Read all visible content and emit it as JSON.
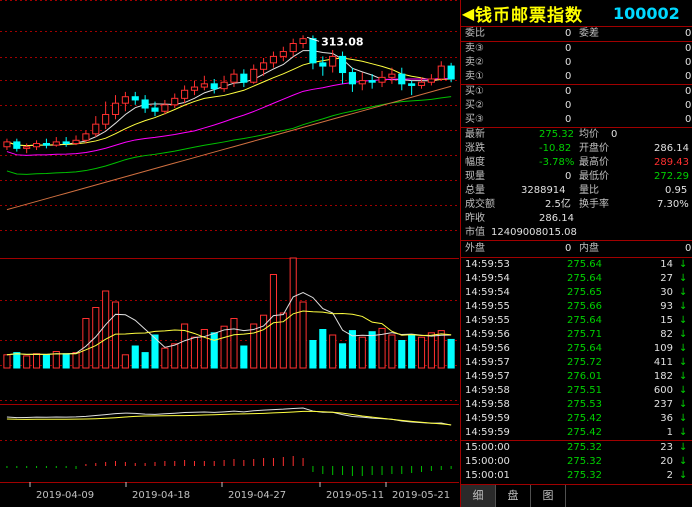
{
  "stock": {
    "name": "钱币邮票指数",
    "code": "100002",
    "nav_prev": "◀",
    "nav_next": "▶"
  },
  "order_book": {
    "ratio_label": "委比",
    "ratio_value": "0",
    "diff_label": "委差",
    "diff_value": "0",
    "sells": [
      {
        "label": "卖③",
        "price": "",
        "vol": "0"
      },
      {
        "label": "卖②",
        "price": "",
        "vol": "0"
      },
      {
        "label": "卖①",
        "price": "",
        "vol": "0"
      }
    ],
    "buys": [
      {
        "label": "买①",
        "price": "",
        "vol": "0"
      },
      {
        "label": "买②",
        "price": "",
        "vol": "0"
      },
      {
        "label": "买③",
        "price": "",
        "vol": "0"
      }
    ],
    "zero": "0"
  },
  "quote": {
    "latest_label": "最新",
    "latest": "275.32",
    "avg_label": "均价",
    "avg": "0",
    "change_label": "涨跌",
    "change": "-10.82",
    "open_label": "开盘价",
    "open": "286.14",
    "pct_label": "幅度",
    "pct": "-3.78%",
    "high_label": "最高价",
    "high": "289.43",
    "cur_vol_label": "现量",
    "cur_vol": "0",
    "low_label": "最低价",
    "low": "272.29",
    "total_vol_label": "总量",
    "total_vol": "3288914",
    "vol_ratio_label": "量比",
    "vol_ratio": "0.95",
    "amount_label": "成交额",
    "amount": "2.5亿",
    "turnover_label": "换手率",
    "turnover": "7.30%",
    "prev_close_label": "昨收",
    "prev_close": "286.14",
    "mkt_cap_label": "市值",
    "mkt_cap": "12409008015.08"
  },
  "outer_inner": {
    "outer_label": "外盘",
    "outer": "0",
    "inner_label": "内盘",
    "inner": "0"
  },
  "ticks": [
    {
      "time": "14:59:53",
      "price": "275.64",
      "vol": "14",
      "dir": "down"
    },
    {
      "time": "14:59:54",
      "price": "275.64",
      "vol": "27",
      "dir": "down"
    },
    {
      "time": "14:59:54",
      "price": "275.65",
      "vol": "30",
      "dir": "down"
    },
    {
      "time": "14:59:55",
      "price": "275.66",
      "vol": "93",
      "dir": "down"
    },
    {
      "time": "14:59:55",
      "price": "275.64",
      "vol": "15",
      "dir": "down"
    },
    {
      "time": "14:59:56",
      "price": "275.71",
      "vol": "82",
      "dir": "down"
    },
    {
      "time": "14:59:56",
      "price": "275.64",
      "vol": "109",
      "dir": "down"
    },
    {
      "time": "14:59:57",
      "price": "275.72",
      "vol": "411",
      "dir": "down"
    },
    {
      "time": "14:59:57",
      "price": "276.01",
      "vol": "182",
      "dir": "down"
    },
    {
      "time": "14:59:58",
      "price": "275.51",
      "vol": "600",
      "dir": "down"
    },
    {
      "time": "14:59:58",
      "price": "275.53",
      "vol": "237",
      "dir": "down"
    },
    {
      "time": "14:59:59",
      "price": "275.42",
      "vol": "36",
      "dir": "down"
    },
    {
      "time": "14:59:59",
      "price": "275.42",
      "vol": "1",
      "dir": "down"
    },
    {
      "time": "15:00:00",
      "price": "275.32",
      "vol": "23",
      "dir": "down"
    },
    {
      "time": "15:00:00",
      "price": "275.32",
      "vol": "20",
      "dir": "down"
    },
    {
      "time": "15:00:01",
      "price": "275.32",
      "vol": "2",
      "dir": "down"
    }
  ],
  "tabs": [
    "细",
    "盘",
    "图"
  ],
  "colors": {
    "up": "#ff3030",
    "down": "#00ffff",
    "ma_white": "#e0e0e0",
    "ma_yellow": "#ffff40",
    "ma_magenta": "#ff00ff",
    "ma_green": "#00c000",
    "ma_orange": "#d07040",
    "grid": "#a00000"
  },
  "chart_data": {
    "type": "candlestick",
    "high_label": "313.08",
    "x_labels": [
      "2019-04-09",
      "2019-04-18",
      "2019-04-27",
      "2019-05-11",
      "2019-05-21"
    ],
    "ylim": [
      180,
      330
    ],
    "candles": [
      {
        "o": 244,
        "c": 247,
        "h": 249,
        "l": 242
      },
      {
        "o": 247,
        "c": 243,
        "h": 249,
        "l": 241
      },
      {
        "o": 243,
        "c": 244,
        "h": 246,
        "l": 240
      },
      {
        "o": 244,
        "c": 246,
        "h": 248,
        "l": 242
      },
      {
        "o": 246,
        "c": 245,
        "h": 249,
        "l": 243
      },
      {
        "o": 245,
        "c": 247,
        "h": 250,
        "l": 244
      },
      {
        "o": 247,
        "c": 246,
        "h": 250,
        "l": 244
      },
      {
        "o": 246,
        "c": 248,
        "h": 251,
        "l": 245
      },
      {
        "o": 248,
        "c": 252,
        "h": 254,
        "l": 246
      },
      {
        "o": 252,
        "c": 258,
        "h": 263,
        "l": 250
      },
      {
        "o": 258,
        "c": 264,
        "h": 272,
        "l": 255
      },
      {
        "o": 264,
        "c": 271,
        "h": 276,
        "l": 261
      },
      {
        "o": 271,
        "c": 275,
        "h": 278,
        "l": 266
      },
      {
        "o": 275,
        "c": 273,
        "h": 278,
        "l": 270
      },
      {
        "o": 273,
        "c": 268,
        "h": 276,
        "l": 265
      },
      {
        "o": 268,
        "c": 266,
        "h": 272,
        "l": 263
      },
      {
        "o": 266,
        "c": 270,
        "h": 273,
        "l": 264
      },
      {
        "o": 270,
        "c": 274,
        "h": 277,
        "l": 268
      },
      {
        "o": 274,
        "c": 279,
        "h": 282,
        "l": 271
      },
      {
        "o": 279,
        "c": 281,
        "h": 285,
        "l": 276
      },
      {
        "o": 281,
        "c": 283,
        "h": 288,
        "l": 279
      },
      {
        "o": 283,
        "c": 280,
        "h": 286,
        "l": 277
      },
      {
        "o": 280,
        "c": 284,
        "h": 288,
        "l": 278
      },
      {
        "o": 284,
        "c": 289,
        "h": 292,
        "l": 281
      },
      {
        "o": 289,
        "c": 284,
        "h": 292,
        "l": 281
      },
      {
        "o": 284,
        "c": 292,
        "h": 295,
        "l": 283
      },
      {
        "o": 292,
        "c": 296,
        "h": 299,
        "l": 288
      },
      {
        "o": 296,
        "c": 300,
        "h": 303,
        "l": 293
      },
      {
        "o": 300,
        "c": 303,
        "h": 306,
        "l": 297
      },
      {
        "o": 303,
        "c": 308,
        "h": 311,
        "l": 300
      },
      {
        "o": 308,
        "c": 311,
        "h": 313.08,
        "l": 305
      },
      {
        "o": 311,
        "c": 296,
        "h": 313,
        "l": 292
      },
      {
        "o": 296,
        "c": 294,
        "h": 300,
        "l": 288
      },
      {
        "o": 294,
        "c": 300,
        "h": 304,
        "l": 290
      },
      {
        "o": 300,
        "c": 290,
        "h": 303,
        "l": 283
      },
      {
        "o": 290,
        "c": 283,
        "h": 293,
        "l": 278
      },
      {
        "o": 283,
        "c": 285,
        "h": 290,
        "l": 279
      },
      {
        "o": 285,
        "c": 284,
        "h": 289,
        "l": 280
      },
      {
        "o": 284,
        "c": 287,
        "h": 291,
        "l": 281
      },
      {
        "o": 287,
        "c": 289,
        "h": 293,
        "l": 283
      },
      {
        "o": 289,
        "c": 283,
        "h": 293,
        "l": 279
      },
      {
        "o": 283,
        "c": 282,
        "h": 285,
        "l": 276
      },
      {
        "o": 282,
        "c": 284,
        "h": 287,
        "l": 280
      },
      {
        "o": 284,
        "c": 286,
        "h": 289,
        "l": 282
      },
      {
        "o": 286,
        "c": 294,
        "h": 297,
        "l": 285
      },
      {
        "o": 294,
        "c": 286,
        "h": 296,
        "l": 284
      }
    ],
    "volume": {
      "ylim": [
        0,
        100
      ],
      "values": [
        12,
        14,
        11,
        13,
        12,
        15,
        13,
        14,
        45,
        55,
        70,
        60,
        12,
        20,
        14,
        30,
        18,
        22,
        40,
        28,
        35,
        32,
        38,
        45,
        20,
        40,
        48,
        85,
        50,
        100,
        60,
        25,
        35,
        30,
        22,
        34,
        28,
        33,
        36,
        30,
        25,
        30,
        28,
        32,
        34,
        26
      ]
    },
    "macd_hist": [
      -2,
      -2,
      -2,
      -2,
      -2,
      -2,
      -2,
      -3,
      2,
      3,
      4,
      5,
      4,
      3,
      3,
      4,
      5,
      5,
      6,
      5,
      5,
      5,
      6,
      7,
      6,
      7,
      8,
      8,
      9,
      10,
      8,
      -6,
      -8,
      -9,
      -9,
      -10,
      -10,
      -9,
      -9,
      -8,
      -8,
      -7,
      -6,
      -5,
      -4,
      -3
    ]
  }
}
